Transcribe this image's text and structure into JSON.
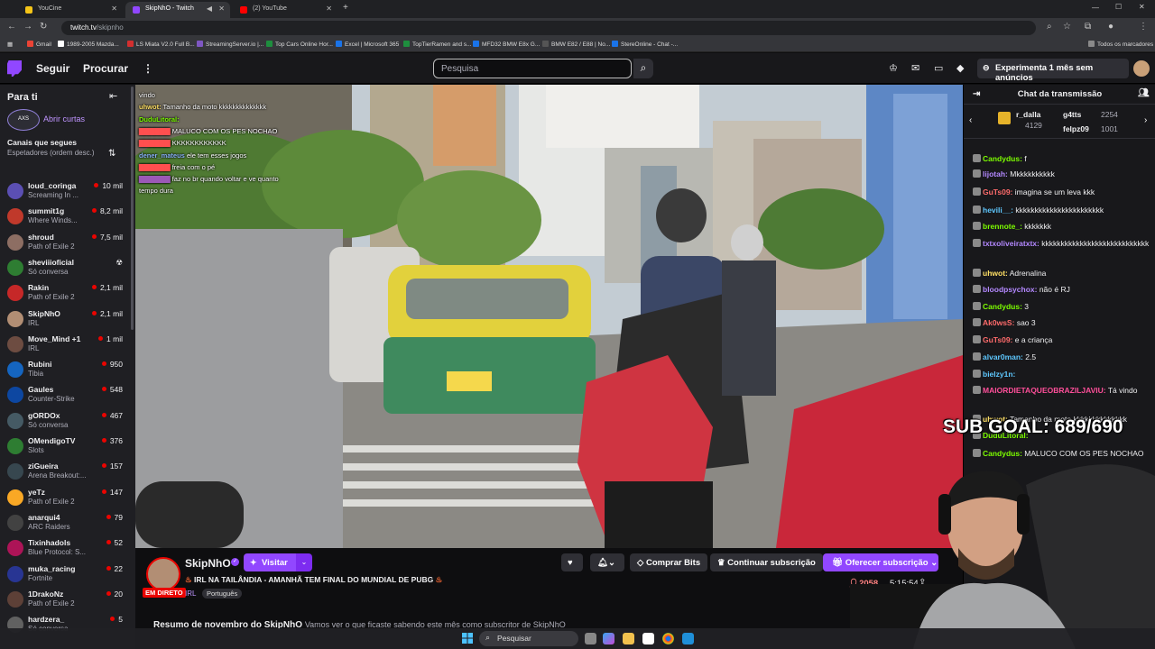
{
  "browser": {
    "tabs": [
      {
        "title": "YouCine",
        "color": "#f5c518",
        "active": false
      },
      {
        "title": "SkipNhO - Twitch",
        "color": "#9147ff",
        "active": true
      },
      {
        "title": "(2) YouTube",
        "color": "#ff0000",
        "active": false
      }
    ],
    "url_host": "twitch.tv",
    "url_path": "/skipnho",
    "bookmarks": [
      {
        "label": "Gmail",
        "color": "#ea4335"
      },
      {
        "label": "1989-2005 Mazda...",
        "color": "#ffffff"
      },
      {
        "label": "LS Miata V2.0 Full B...",
        "color": "#d32f2f"
      },
      {
        "label": "StreamingServer.io |...",
        "color": "#7e57c2"
      },
      {
        "label": "Top Cars Online Hor...",
        "color": "#1e8e3e"
      },
      {
        "label": "Excel | Microsoft 365",
        "color": "#1a73e8"
      },
      {
        "label": "TopTierRamen and s...",
        "color": "#1e8e3e"
      },
      {
        "label": "MFD32 BMW E8x G...",
        "color": "#1a73e8"
      },
      {
        "label": "BMW E82 / E88 | No...",
        "color": "#555555"
      },
      {
        "label": "StereOnline - Chat -...",
        "color": "#1a73e8"
      }
    ],
    "all_bookmarks": "Todos os marcadores"
  },
  "topnav": {
    "follow": "Seguir",
    "browse": "Procurar",
    "search_placeholder": "Pesquisa",
    "promo": "Experimenta 1 mês sem anúncios"
  },
  "sidebar": {
    "heading": "Para ti",
    "shorts": "Abrir curtas",
    "shorts_avatar_text": "AXS",
    "followed_heading": "Canais que segues",
    "followed_sub": "Espetadores (ordem desc.)",
    "channels": [
      {
        "name": "loud_coringa",
        "game": "Screaming In ...",
        "viewers": "10 mil",
        "color": "#5b4fb3"
      },
      {
        "name": "summit1g",
        "game": "Where Winds...",
        "viewers": "8,2 mil",
        "color": "#c0392b"
      },
      {
        "name": "shroud",
        "game": "Path of Exile 2",
        "viewers": "7,5 mil",
        "color": "#8d6e63"
      },
      {
        "name": "sheviiioficial",
        "game": "Só conversa",
        "viewers": "",
        "color": "#2e7d32"
      },
      {
        "name": "Rakin",
        "game": "Path of Exile 2",
        "viewers": "2,1 mil",
        "color": "#c62828"
      },
      {
        "name": "SkipNhO",
        "game": "IRL",
        "viewers": "2,1 mil",
        "color": "#b28e74"
      },
      {
        "name": "Move_Mind +1",
        "game": "IRL",
        "viewers": "1 mil",
        "color": "#6d4c41"
      },
      {
        "name": "Rubini",
        "game": "Tibia",
        "viewers": "950",
        "color": "#1565c0"
      },
      {
        "name": "Gaules",
        "game": "Counter-Strike",
        "viewers": "548",
        "color": "#0d47a1"
      },
      {
        "name": "gORDOx",
        "game": "Só conversa",
        "viewers": "467",
        "color": "#455a64"
      },
      {
        "name": "OMendigoTV",
        "game": "Slots",
        "viewers": "376",
        "color": "#2e7d32"
      },
      {
        "name": "ziGueira",
        "game": "Arena Breakout:...",
        "viewers": "157",
        "color": "#37474f"
      },
      {
        "name": "yeTz",
        "game": "Path of Exile 2",
        "viewers": "147",
        "color": "#f9a825"
      },
      {
        "name": "anarqui4",
        "game": "ARC Raiders",
        "viewers": "79",
        "color": "#424242"
      },
      {
        "name": "Tixinhadols",
        "game": "Blue Protocol: S...",
        "viewers": "52",
        "color": "#ad1457"
      },
      {
        "name": "muka_racing",
        "game": "Fortnite",
        "viewers": "22",
        "color": "#283593"
      },
      {
        "name": "1DrakoNz",
        "game": "Path of Exile 2",
        "viewers": "20",
        "color": "#5d4037"
      },
      {
        "name": "hardzera_",
        "game": "Só conversa",
        "viewers": "5",
        "color": "#616161"
      }
    ]
  },
  "overlay_chat": [
    {
      "user": "",
      "user_color": "#ff4f4f",
      "text": "",
      "extra": "vindo"
    },
    {
      "user": "uhwot:",
      "user_color": "#ffe066",
      "text": "Tamanho da moto kkkkkkkkkkkkkk",
      "extra": ""
    },
    {
      "user": "DuduLitoral:",
      "user_color": "#7cfc00",
      "text": "",
      "extra": ""
    },
    {
      "user": "",
      "user_color": "#ff4f4f",
      "text": "MALUCO COM OS PES NOCHAO",
      "extra": ""
    },
    {
      "user": "",
      "user_color": "#ff4f4f",
      "text": "KKKKKKKKKKKK",
      "extra": ""
    },
    {
      "user": "dener_mateus",
      "user_color": "#8ab4f8",
      "text": "ele tem esses jogos",
      "extra": ""
    },
    {
      "user": "",
      "user_color": "#ff4f4f",
      "text": "freia com o pé",
      "extra": ""
    },
    {
      "user": "",
      "user_color": "#9b59b6",
      "text": "faz no br quando voltar e ve quanto",
      "extra": ""
    },
    {
      "user": "",
      "user_color": "#ffffff",
      "text": "tempo dura",
      "extra": ""
    }
  ],
  "stream": {
    "channel": "SkipNhO",
    "visit": "Visitar",
    "title": "IRL NA TAILÂNDIA - AMANHÃ TEM FINAL DO MUNDIAL DE PUBG",
    "live": "EM DIRETO",
    "category": "IRL",
    "language": "Português",
    "bits": "Comprar Bits",
    "continue_sub": "Continuar subscrição",
    "gift_sub": "Oferecer subscrição",
    "viewers": "2058",
    "uptime": "5:15:54",
    "recap_title": "Resumo de novembro do SkipNhO",
    "recap_sub": "Vamos ver o que ficaste sabendo este mês como subscritor de SkipNhO"
  },
  "chat": {
    "header": "Chat da transmissão",
    "leaderboard": [
      {
        "name": "r_dalla",
        "value": "4129"
      },
      {
        "name": "g4tts",
        "value": "2254"
      },
      {
        "name": "felpz09",
        "value": "1001"
      }
    ],
    "messages": [
      {
        "user": "Candydus:",
        "color": "#7cfc00",
        "text": "f"
      },
      {
        "user": "lijotah:",
        "color": "#b388ff",
        "text": "Mkkkkkkkkkk"
      },
      {
        "user": "GuTs09:",
        "color": "#ff6b6b",
        "text": "imagina se um leva kkk"
      },
      {
        "user": "hevili__:",
        "color": "#5ec8ff",
        "text": "kkkkkkkkkkkkkkkkkkkkkkk"
      },
      {
        "user": "brennote_:",
        "color": "#7cfc00",
        "text": "kkkkkkk"
      },
      {
        "user": "txtxoliveiratxtx:",
        "color": "#b388ff",
        "text": "kkkkkkkkkkkkkkkkkkkkkkkkkkkk"
      },
      {
        "user": "uhwot:",
        "color": "#ffe066",
        "text": "Adrenalina"
      },
      {
        "user": "bloodpsychox:",
        "color": "#b388ff",
        "text": "não é RJ"
      },
      {
        "user": "Candydus:",
        "color": "#7cfc00",
        "text": "3"
      },
      {
        "user": "Ak0wsS:",
        "color": "#ff6b6b",
        "text": "sao 3"
      },
      {
        "user": "GuTs09:",
        "color": "#ff6b6b",
        "text": "e a criança"
      },
      {
        "user": "alvar0man:",
        "color": "#5ec8ff",
        "text": "2.5"
      },
      {
        "user": "bielzy1n:",
        "color": "#5ec8ff",
        "text": ""
      },
      {
        "user": "MAIORDIETAQUEOBRAZILJAVIU:",
        "color": "#ff4f9a",
        "text": "Tá vindo"
      },
      {
        "user": "uhwot:",
        "color": "#ffe066",
        "text": "Tamanho da moto kkkkkkkkkkkkkk"
      },
      {
        "user": "DuduLitoral:",
        "color": "#7cfc00",
        "text": ""
      },
      {
        "user": "Candydus:",
        "color": "#7cfc00",
        "text": "MALUCO COM OS PES NOCHAO"
      }
    ]
  },
  "overlay": {
    "sub_goal": "SUB GOAL: 689/690"
  },
  "taskbar": {
    "search": "Pesquisar"
  }
}
